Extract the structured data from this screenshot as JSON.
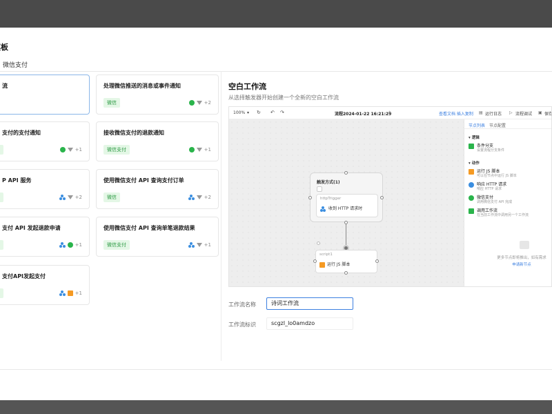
{
  "modal": {
    "title": "模板",
    "tab": "微信支付"
  },
  "cards": [
    {
      "title": "流",
      "badge": "",
      "count": "",
      "selected": true
    },
    {
      "title": "处理微信推送的消息或事件通知",
      "badge": "微信",
      "count": "+2",
      "selected": false
    },
    {
      "title": "支付的支付通知",
      "badge": "",
      "count": "+1",
      "selected": false
    },
    {
      "title": "接收微信支付的退款通知",
      "badge": "微信支付",
      "count": "+1",
      "selected": false
    },
    {
      "title": "P API 服务",
      "badge": "",
      "count": "+2",
      "selected": false
    },
    {
      "title": "使用微信支付 API 查询支付订单",
      "badge": "微信",
      "count": "+2",
      "selected": false
    },
    {
      "title": "支付 API 发起退款申请",
      "badge": "",
      "count": "+1",
      "selected": false
    },
    {
      "title": "使用微信支付 API 查询单笔退款结果",
      "badge": "微信支付",
      "count": "+1",
      "selected": false
    },
    {
      "title": "支付API发起支付",
      "badge": "",
      "count": "+1",
      "selected": false
    }
  ],
  "right": {
    "title": "空白工作流",
    "subtitle": "从选择触发器开始创建一个全新的空白工作流"
  },
  "editor": {
    "zoom": "100%",
    "flow_title": "流程2024-01-22 16:21:29",
    "toolbar_links": "查看文档  插入复制",
    "run_log": "运行日志",
    "debug": "流程调试",
    "save": "保存",
    "panel_tabs": [
      "节点列表",
      "节点配置"
    ],
    "sections": [
      "逻辑",
      "动作"
    ],
    "items": [
      {
        "title": "条件分支",
        "desc": "设置流程分支条件"
      },
      {
        "title": "运行 JS 脚本",
        "desc": "可以在节点中运行 JS 脚本"
      },
      {
        "title": "响应 HTTP 请求",
        "desc": "响应 HTTP 请求"
      },
      {
        "title": "微信支付",
        "desc": "调用微信支付 API 完成"
      },
      {
        "title": "调用工作流",
        "desc": "在当前工作流中调用另一个工作流"
      }
    ],
    "empty_text": "更多节点即将推出，如有需求",
    "empty_link": "申请新节点",
    "group_label": "触发方式(1)",
    "trigger_head": "httpTrigger",
    "trigger_body": "收到 HTTP 请求时",
    "script_head": "script1",
    "script_body": "运行 JS 脚本"
  },
  "form": {
    "name_label": "工作流名称",
    "name_value": "诗词工作流",
    "id_label": "工作流标识",
    "id_value": "scgzl_lo0amdzo"
  },
  "colors": {
    "wechat_green": "#2ab44b",
    "accent_blue": "#3b7fe0",
    "js_orange": "#f59a23"
  }
}
